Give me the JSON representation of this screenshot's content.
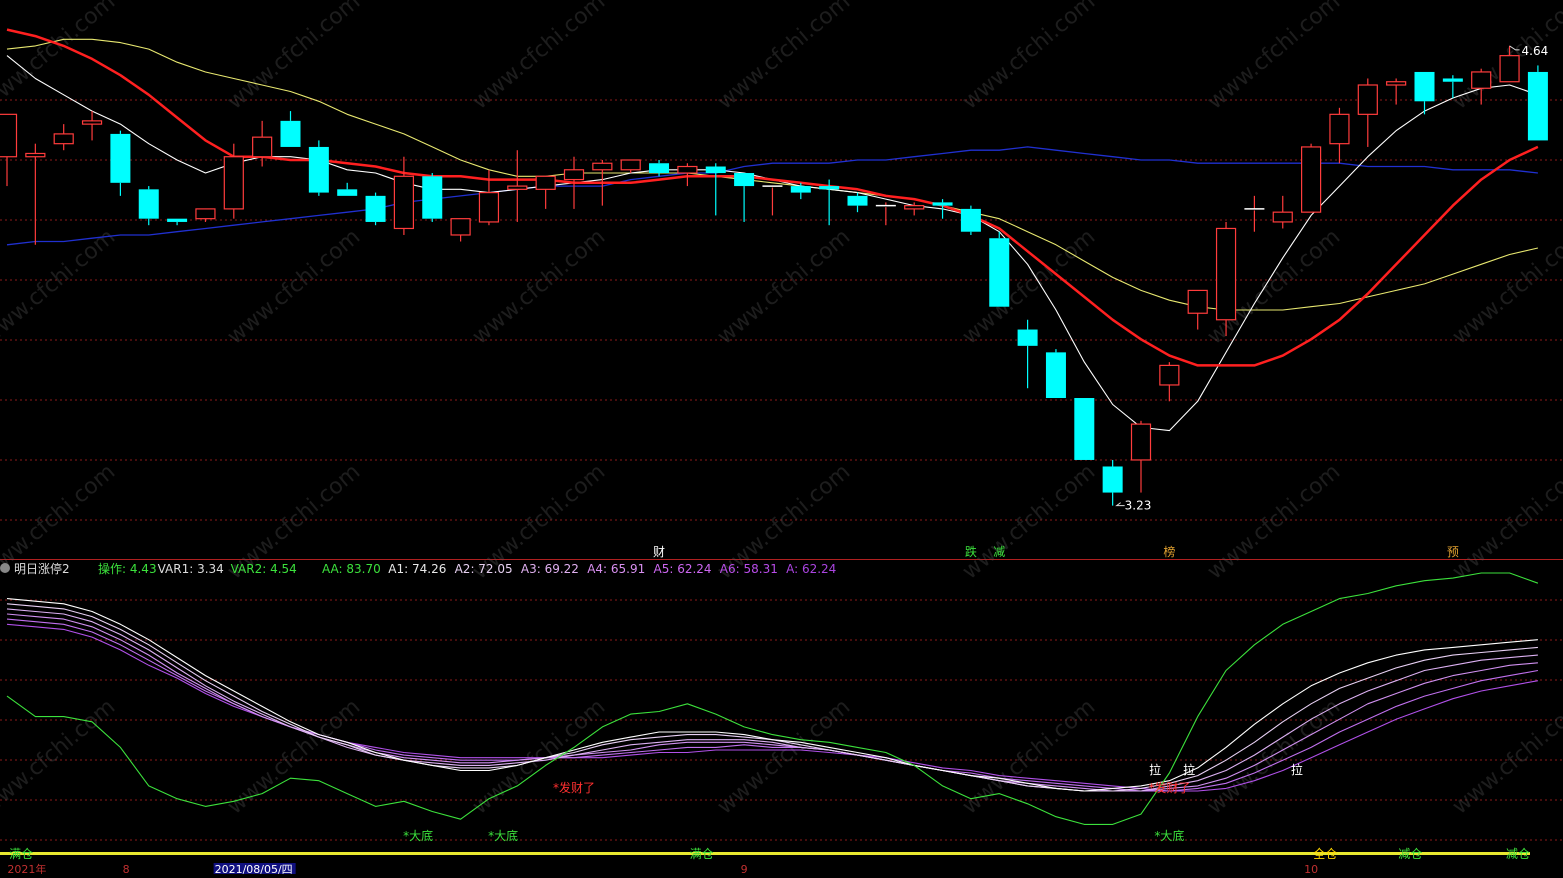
{
  "indicator": {
    "name": "明日涨停2",
    "stats": [
      {
        "label": "操作:",
        "value": "4.43",
        "color": "#3CE13C"
      },
      {
        "label": "VAR1:",
        "value": "3.34",
        "color": "#DDDDDD"
      },
      {
        "label": "VAR2:",
        "value": "4.54",
        "color": "#3CE13C"
      },
      {
        "label": "AA:",
        "value": "83.70",
        "color": "#3CE13C"
      },
      {
        "label": "A1:",
        "value": "74.26",
        "color": "#E8E8E8"
      },
      {
        "label": "A2:",
        "value": "72.05",
        "color": "#E6D0F0"
      },
      {
        "label": "A3:",
        "value": "69.22",
        "color": "#E0B0F0"
      },
      {
        "label": "A4:",
        "value": "65.91",
        "color": "#D890F0"
      },
      {
        "label": "A5:",
        "value": "62.24",
        "color": "#CC66F0"
      },
      {
        "label": "A6:",
        "value": "58.31",
        "color": "#B84CE8"
      },
      {
        "label": "A:",
        "value": "62.24",
        "color": "#AA44E0"
      }
    ]
  },
  "price_markers": {
    "high": "4.64",
    "low": "3.23"
  },
  "event_labels": [
    {
      "text": "财",
      "idx": 23,
      "color": "#FFFFFF"
    },
    {
      "text": "跌",
      "idx": 34,
      "color": "#3CE13C"
    },
    {
      "text": "减",
      "idx": 35,
      "color": "#3CE13C"
    },
    {
      "text": "榜",
      "idx": 41,
      "color": "#E0A030"
    },
    {
      "text": "预",
      "idx": 51,
      "color": "#E0A030"
    }
  ],
  "signal_labels": [
    {
      "text": "*大底",
      "idx": 14.5,
      "row": "bottom",
      "color": "#3CE13C"
    },
    {
      "text": "*大底",
      "idx": 17.5,
      "row": "bottom",
      "color": "#3CE13C"
    },
    {
      "text": "*发财了",
      "idx": 20,
      "row": "mid",
      "color": "#FF3030"
    },
    {
      "text": "*发财了",
      "idx": 41,
      "row": "mid",
      "color": "#FF3030"
    },
    {
      "text": "*大底",
      "idx": 41,
      "row": "bottom",
      "color": "#3CE13C"
    },
    {
      "text": "拉",
      "idx": 40.5,
      "row": "top",
      "color": "#FFFFFF"
    },
    {
      "text": "拉",
      "idx": 41.7,
      "row": "top",
      "color": "#FFFFFF"
    },
    {
      "text": "拉",
      "idx": 45.5,
      "row": "top",
      "color": "#FFFFFF"
    }
  ],
  "bottom_bar": {
    "items": [
      {
        "text": "满仓",
        "idx": 0.5,
        "color": "#3CE13C"
      },
      {
        "text": "满仓",
        "idx": 24.5,
        "color": "#3CE13C"
      },
      {
        "text": "全仓",
        "idx": 46.5,
        "color": "#FFD700"
      },
      {
        "text": "减仓",
        "idx": 49.5,
        "color": "#3CE13C"
      },
      {
        "text": "减仓",
        "idx": 53.3,
        "color": "#3CE13C"
      }
    ],
    "axis": [
      {
        "text": "2021年",
        "idx": 0.7,
        "color": "#C03030"
      },
      {
        "text": "8",
        "idx": 4.2,
        "color": "#C03030"
      },
      {
        "text": "2021/08/05/四",
        "idx": 8.7,
        "color": "#FFFFFF",
        "highlight": true
      },
      {
        "text": "9",
        "idx": 26,
        "color": "#C03030"
      },
      {
        "text": "10",
        "idx": 46,
        "color": "#C03030"
      }
    ]
  },
  "watermark": "www.cfchi.com",
  "colors": {
    "up": "#FF3C3C",
    "down": "#00FFFF",
    "ma_white": "#FFFFFF",
    "ma_red": "#FF2020",
    "ma_yellow": "#E8E870",
    "ma_blue": "#2030D0",
    "grid": "#8B1A1A",
    "aa_line": "#3CE13C"
  },
  "chart_data": {
    "type": "candlestick",
    "ylim": [
      3.1,
      4.75
    ],
    "candles": [
      {
        "o": 4.3,
        "h": 4.43,
        "l": 4.21,
        "c": 4.43
      },
      {
        "o": 4.3,
        "h": 4.34,
        "l": 4.03,
        "c": 4.31
      },
      {
        "o": 4.34,
        "h": 4.4,
        "l": 4.32,
        "c": 4.37
      },
      {
        "o": 4.4,
        "h": 4.44,
        "l": 4.35,
        "c": 4.41
      },
      {
        "o": 4.37,
        "h": 4.38,
        "l": 4.18,
        "c": 4.22
      },
      {
        "o": 4.2,
        "h": 4.21,
        "l": 4.09,
        "c": 4.11
      },
      {
        "o": 4.11,
        "h": 4.11,
        "l": 4.09,
        "c": 4.1
      },
      {
        "o": 4.11,
        "h": 4.14,
        "l": 4.1,
        "c": 4.14
      },
      {
        "o": 4.14,
        "h": 4.34,
        "l": 4.11,
        "c": 4.3
      },
      {
        "o": 4.3,
        "h": 4.41,
        "l": 4.27,
        "c": 4.36
      },
      {
        "o": 4.41,
        "h": 4.44,
        "l": 4.33,
        "c": 4.33
      },
      {
        "o": 4.33,
        "h": 4.35,
        "l": 4.18,
        "c": 4.19
      },
      {
        "o": 4.2,
        "h": 4.22,
        "l": 4.18,
        "c": 4.18
      },
      {
        "o": 4.18,
        "h": 4.19,
        "l": 4.09,
        "c": 4.1
      },
      {
        "o": 4.08,
        "h": 4.3,
        "l": 4.06,
        "c": 4.24
      },
      {
        "o": 4.24,
        "h": 4.25,
        "l": 4.1,
        "c": 4.11
      },
      {
        "o": 4.06,
        "h": 4.11,
        "l": 4.04,
        "c": 4.11
      },
      {
        "o": 4.1,
        "h": 4.26,
        "l": 4.09,
        "c": 4.19
      },
      {
        "o": 4.2,
        "h": 4.32,
        "l": 4.1,
        "c": 4.21
      },
      {
        "o": 4.2,
        "h": 4.24,
        "l": 4.14,
        "c": 4.24
      },
      {
        "o": 4.23,
        "h": 4.3,
        "l": 4.14,
        "c": 4.26
      },
      {
        "o": 4.26,
        "h": 4.29,
        "l": 4.15,
        "c": 4.28
      },
      {
        "o": 4.26,
        "h": 4.29,
        "l": 4.25,
        "c": 4.29
      },
      {
        "o": 4.28,
        "h": 4.29,
        "l": 4.24,
        "c": 4.25
      },
      {
        "o": 4.25,
        "h": 4.28,
        "l": 4.21,
        "c": 4.27
      },
      {
        "o": 4.27,
        "h": 4.28,
        "l": 4.12,
        "c": 4.25
      },
      {
        "o": 4.25,
        "h": 4.25,
        "l": 4.1,
        "c": 4.21
      },
      {
        "o": 4.21,
        "h": 4.21,
        "l": 4.12,
        "c": 4.21
      },
      {
        "o": 4.21,
        "h": 4.22,
        "l": 4.17,
        "c": 4.19
      },
      {
        "o": 4.21,
        "h": 4.23,
        "l": 4.09,
        "c": 4.2
      },
      {
        "o": 4.18,
        "h": 4.19,
        "l": 4.13,
        "c": 4.15
      },
      {
        "o": 4.15,
        "h": 4.16,
        "l": 4.09,
        "c": 4.15
      },
      {
        "o": 4.14,
        "h": 4.16,
        "l": 4.12,
        "c": 4.15
      },
      {
        "o": 4.16,
        "h": 4.17,
        "l": 4.11,
        "c": 4.15
      },
      {
        "o": 4.14,
        "h": 4.15,
        "l": 4.06,
        "c": 4.07
      },
      {
        "o": 4.05,
        "h": 4.07,
        "l": 3.84,
        "c": 3.84
      },
      {
        "o": 3.77,
        "h": 3.8,
        "l": 3.59,
        "c": 3.72
      },
      {
        "o": 3.7,
        "h": 3.71,
        "l": 3.56,
        "c": 3.56
      },
      {
        "o": 3.56,
        "h": 3.56,
        "l": 3.37,
        "c": 3.37
      },
      {
        "o": 3.35,
        "h": 3.37,
        "l": 3.23,
        "c": 3.27
      },
      {
        "o": 3.37,
        "h": 3.49,
        "l": 3.27,
        "c": 3.48
      },
      {
        "o": 3.6,
        "h": 3.67,
        "l": 3.55,
        "c": 3.66
      },
      {
        "o": 3.82,
        "h": 3.88,
        "l": 3.77,
        "c": 3.89
      },
      {
        "o": 3.8,
        "h": 4.1,
        "l": 3.75,
        "c": 4.08
      },
      {
        "o": 4.14,
        "h": 4.18,
        "l": 4.07,
        "c": 4.14
      },
      {
        "o": 4.1,
        "h": 4.18,
        "l": 4.08,
        "c": 4.13
      },
      {
        "o": 4.13,
        "h": 4.34,
        "l": 4.13,
        "c": 4.33
      },
      {
        "o": 4.34,
        "h": 4.45,
        "l": 4.28,
        "c": 4.43
      },
      {
        "o": 4.43,
        "h": 4.54,
        "l": 4.33,
        "c": 4.52
      },
      {
        "o": 4.52,
        "h": 4.54,
        "l": 4.46,
        "c": 4.53
      },
      {
        "o": 4.56,
        "h": 4.56,
        "l": 4.43,
        "c": 4.47
      },
      {
        "o": 4.54,
        "h": 4.55,
        "l": 4.48,
        "c": 4.53
      },
      {
        "o": 4.51,
        "h": 4.57,
        "l": 4.46,
        "c": 4.56
      },
      {
        "o": 4.53,
        "h": 4.64,
        "l": 4.53,
        "c": 4.61
      },
      {
        "o": 4.56,
        "h": 4.58,
        "l": 4.35,
        "c": 4.35
      }
    ],
    "ma_white": [
      4.61,
      4.54,
      4.49,
      4.44,
      4.4,
      4.34,
      4.29,
      4.25,
      4.28,
      4.3,
      4.3,
      4.29,
      4.26,
      4.25,
      4.22,
      4.2,
      4.2,
      4.19,
      4.2,
      4.21,
      4.22,
      4.23,
      4.25,
      4.26,
      4.26,
      4.26,
      4.25,
      4.23,
      4.21,
      4.2,
      4.19,
      4.17,
      4.15,
      4.14,
      4.12,
      4.07,
      3.97,
      3.83,
      3.67,
      3.54,
      3.47,
      3.46,
      3.55,
      3.7,
      3.85,
      3.99,
      4.12,
      4.21,
      4.3,
      4.38,
      4.44,
      4.48,
      4.51,
      4.52,
      4.49
    ],
    "ma_red": [
      4.69,
      4.67,
      4.64,
      4.6,
      4.55,
      4.49,
      4.42,
      4.35,
      4.3,
      4.3,
      4.29,
      4.29,
      4.28,
      4.27,
      4.25,
      4.24,
      4.24,
      4.23,
      4.23,
      4.23,
      4.22,
      4.22,
      4.22,
      4.23,
      4.24,
      4.24,
      4.24,
      4.23,
      4.22,
      4.21,
      4.2,
      4.18,
      4.17,
      4.15,
      4.12,
      4.08,
      4.01,
      3.94,
      3.87,
      3.8,
      3.74,
      3.69,
      3.66,
      3.66,
      3.66,
      3.69,
      3.74,
      3.8,
      3.88,
      3.97,
      4.06,
      4.15,
      4.23,
      4.29,
      4.33
    ],
    "ma_yellow": [
      4.63,
      4.64,
      4.66,
      4.66,
      4.65,
      4.63,
      4.59,
      4.56,
      4.54,
      4.52,
      4.5,
      4.47,
      4.43,
      4.4,
      4.37,
      4.33,
      4.29,
      4.26,
      4.24,
      4.24,
      4.25,
      4.25,
      4.25,
      4.25,
      4.25,
      4.24,
      4.23,
      4.22,
      4.21,
      4.2,
      4.19,
      4.18,
      4.17,
      4.15,
      4.13,
      4.11,
      4.07,
      4.03,
      3.98,
      3.93,
      3.89,
      3.86,
      3.84,
      3.83,
      3.83,
      3.83,
      3.84,
      3.85,
      3.87,
      3.89,
      3.91,
      3.94,
      3.97,
      4.0,
      4.02
    ],
    "ma_blue": [
      4.03,
      4.04,
      4.04,
      4.05,
      4.06,
      4.06,
      4.07,
      4.08,
      4.09,
      4.1,
      4.11,
      4.12,
      4.13,
      4.14,
      4.16,
      4.17,
      4.18,
      4.19,
      4.2,
      4.21,
      4.21,
      4.21,
      4.23,
      4.24,
      4.25,
      4.25,
      4.27,
      4.28,
      4.28,
      4.28,
      4.29,
      4.29,
      4.3,
      4.31,
      4.32,
      4.32,
      4.33,
      4.32,
      4.31,
      4.3,
      4.29,
      4.29,
      4.28,
      4.28,
      4.28,
      4.28,
      4.28,
      4.28,
      4.27,
      4.27,
      4.27,
      4.26,
      4.26,
      4.26,
      4.25
    ],
    "indicator_ylim": [
      0,
      100
    ],
    "aa": [
      60,
      52,
      52,
      50,
      40,
      25,
      20,
      17,
      19,
      22,
      28,
      27,
      22,
      17,
      19,
      15,
      12,
      20,
      25,
      33,
      40,
      48,
      53,
      54,
      57,
      53,
      48,
      45,
      43,
      42,
      40,
      38,
      33,
      25,
      20,
      22,
      18,
      13,
      10,
      10,
      14,
      30,
      52,
      70,
      80,
      88,
      93,
      98,
      100,
      103,
      105,
      106,
      108,
      108,
      104
    ],
    "a_bundle": [
      {
        "name": "A1",
        "values": [
          98,
          97,
          96,
          93,
          88,
          82,
          75,
          68,
          62,
          56,
          50,
          45,
          42,
          38,
          35,
          33,
          31,
          31,
          33,
          36,
          39,
          42,
          44,
          46,
          46,
          46,
          45,
          43,
          42,
          40,
          38,
          36,
          33,
          31,
          29,
          28,
          26,
          24,
          23,
          24,
          25,
          27,
          32,
          40,
          49,
          57,
          64,
          69,
          73,
          76,
          78,
          79,
          80,
          81,
          82
        ]
      },
      {
        "name": "A2",
        "values": [
          96,
          95,
          94,
          91,
          86,
          80,
          73,
          66,
          60,
          54,
          49,
          44,
          41,
          37,
          35,
          33,
          32,
          32,
          33,
          36,
          38,
          41,
          43,
          44,
          45,
          45,
          44,
          43,
          41,
          39,
          37,
          35,
          33,
          31,
          29,
          27,
          25,
          24,
          23,
          23,
          24,
          26,
          29,
          35,
          42,
          50,
          57,
          63,
          67,
          71,
          74,
          76,
          77,
          78,
          79
        ]
      },
      {
        "name": "A3",
        "values": [
          94,
          93,
          92,
          89,
          84,
          78,
          71,
          64,
          58,
          53,
          48,
          44,
          40,
          37,
          35,
          34,
          33,
          33,
          34,
          35,
          37,
          39,
          41,
          42,
          43,
          43,
          43,
          42,
          40,
          39,
          37,
          35,
          33,
          31,
          29,
          27,
          25,
          24,
          23,
          23,
          23,
          25,
          27,
          31,
          37,
          44,
          51,
          57,
          62,
          66,
          70,
          72,
          74,
          75,
          76
        ]
      },
      {
        "name": "A4",
        "values": [
          92,
          91,
          90,
          87,
          82,
          76,
          69,
          63,
          57,
          52,
          48,
          44,
          41,
          38,
          36,
          35,
          34,
          34,
          35,
          36,
          37,
          38,
          39,
          41,
          42,
          42,
          42,
          41,
          40,
          39,
          37,
          35,
          33,
          31,
          29,
          27,
          26,
          25,
          24,
          23,
          23,
          24,
          25,
          28,
          33,
          39,
          45,
          51,
          57,
          61,
          65,
          68,
          70,
          72,
          73
        ]
      },
      {
        "name": "A5",
        "values": [
          90,
          89,
          88,
          85,
          80,
          74,
          68,
          62,
          57,
          52,
          48,
          45,
          42,
          39,
          37,
          36,
          35,
          35,
          35,
          36,
          36,
          37,
          38,
          39,
          40,
          40,
          41,
          40,
          40,
          39,
          37,
          35,
          33,
          31,
          30,
          28,
          27,
          26,
          25,
          24,
          23,
          23,
          24,
          26,
          30,
          35,
          40,
          46,
          51,
          56,
          60,
          63,
          66,
          68,
          70
        ]
      },
      {
        "name": "A6",
        "values": [
          88,
          87,
          86,
          83,
          78,
          72,
          67,
          61,
          56,
          52,
          48,
          45,
          42,
          40,
          38,
          37,
          36,
          36,
          36,
          36,
          36,
          36,
          37,
          38,
          38,
          39,
          39,
          39,
          39,
          38,
          37,
          36,
          34,
          32,
          31,
          29,
          28,
          27,
          26,
          25,
          24,
          23,
          23,
          24,
          27,
          31,
          36,
          41,
          46,
          51,
          55,
          59,
          62,
          64,
          66
        ]
      }
    ]
  }
}
